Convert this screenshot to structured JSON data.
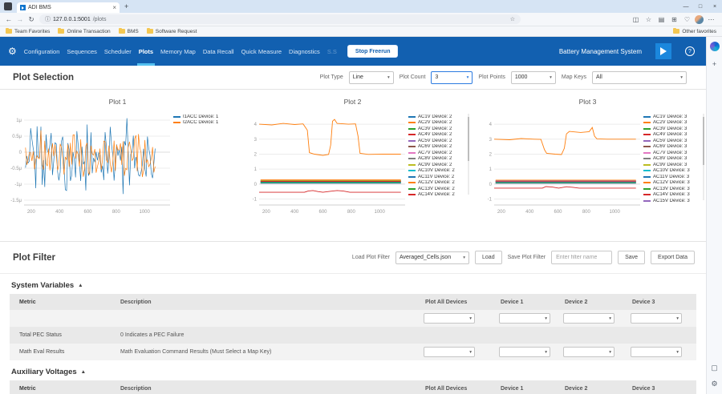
{
  "browser": {
    "tab_title": "ADI BMS",
    "url_host": "127.0.0.1:5001",
    "url_path": "/plots",
    "favorites": [
      "Team Favorites",
      "Online Transaction",
      "BMS",
      "Software Request"
    ],
    "other_favorites": "Other favorites",
    "toolbar_icons": [
      {
        "name": "split-screen-icon",
        "glyph": "◫"
      },
      {
        "name": "favorites-star-icon",
        "glyph": "☆"
      },
      {
        "name": "collections-icon",
        "glyph": "▤"
      },
      {
        "name": "extensions-icon",
        "glyph": "⊞"
      },
      {
        "name": "browser-essentials-icon",
        "glyph": "♡"
      }
    ],
    "sidebar_icons_top": [
      {
        "name": "copilot-icon",
        "glyph": ""
      },
      {
        "name": "add-icon",
        "glyph": "+"
      }
    ],
    "sidebar_icons_bottom": [
      {
        "name": "devices-icon",
        "glyph": "▢"
      },
      {
        "name": "settings-gear-icon",
        "glyph": "⚙"
      }
    ]
  },
  "nav": {
    "items": [
      "Configuration",
      "Sequences",
      "Scheduler",
      "Plots",
      "Memory Map",
      "Data Recall",
      "Quick Measure",
      "Diagnostics"
    ],
    "active_item": "Plots",
    "faint_item": "S.S",
    "stop_button": "Stop Freerun",
    "brand": "Battery Management System"
  },
  "plot_selection": {
    "title": "Plot Selection",
    "controls": [
      {
        "label": "Plot Type",
        "value": "Line",
        "focused": false
      },
      {
        "label": "Plot Count",
        "value": "3",
        "focused": true
      },
      {
        "label": "Plot Points",
        "value": "1000",
        "focused": false
      },
      {
        "label": "Map Keys",
        "value": "All",
        "focused": false
      }
    ]
  },
  "plot_filter": {
    "title": "Plot Filter",
    "load_label": "Load Plot Filter",
    "load_value": "Averaged_Cells.json",
    "load_button": "Load",
    "save_label": "Save Plot Filter",
    "save_placeholder": "Enter filter name",
    "save_button": "Save",
    "export_button": "Export Data"
  },
  "sections": [
    {
      "title": "System Variables",
      "columns": [
        "Metric",
        "Description",
        "Plot All Devices",
        "Device 1",
        "Device 2",
        "Device 3"
      ],
      "rows": [
        {
          "metric": "",
          "description": "",
          "selects": true
        },
        {
          "metric": "Total PEC Status",
          "description": "0 Indicates a PEC Failure",
          "selects": false
        },
        {
          "metric": "Math Eval Results",
          "description": "Math Evaluation Command Results (Must Select a Map Key)",
          "selects": true
        }
      ]
    },
    {
      "title": "Auxiliary Voltages",
      "columns": [
        "Metric",
        "Description",
        "Plot All Devices",
        "Device 1",
        "Device 2",
        "Device 3"
      ],
      "rows": []
    }
  ],
  "chart_data": [
    {
      "type": "line",
      "title": "Plot 1",
      "x_range": [
        150,
        1180
      ],
      "x_ticks": [
        200,
        400,
        600,
        800,
        1000
      ],
      "y_range": [
        -1.65,
        1.2
      ],
      "y_ticks": [
        {
          "v": 1,
          "label": "1μ"
        },
        {
          "v": 0.5,
          "label": "0.5μ"
        },
        {
          "v": 0,
          "label": "0"
        },
        {
          "v": -0.5,
          "label": "-0.5μ"
        },
        {
          "v": -1,
          "label": "-1μ"
        },
        {
          "v": -1.5,
          "label": "-1.5μ"
        }
      ],
      "legend_scroll": false,
      "series": [
        {
          "name": "I1ACC Device: 1",
          "color": "#1f77b4",
          "kind": "noise",
          "mean": -0.22,
          "amplitude": 1.3,
          "seed": 42
        },
        {
          "name": "I2ACC Device: 1",
          "color": "#ff7f0e",
          "kind": "noise",
          "mean": -0.2,
          "amplitude": 0.95,
          "seed": 1337
        }
      ]
    },
    {
      "type": "line",
      "title": "Plot 2",
      "x_range": [
        150,
        1180
      ],
      "x_ticks": [
        200,
        400,
        600,
        800,
        1000
      ],
      "y_range": [
        -1.4,
        4.7
      ],
      "y_ticks": [
        {
          "v": 4,
          "label": "4"
        },
        {
          "v": 3,
          "label": "3"
        },
        {
          "v": 2,
          "label": "2"
        },
        {
          "v": 1,
          "label": "1"
        },
        {
          "v": 0,
          "label": "0"
        },
        {
          "v": -1,
          "label": "-1"
        }
      ],
      "legend_scroll": true,
      "series": [
        {
          "name": "AC1V Device: 2",
          "color": "#1f77b4",
          "kind": "flat",
          "value": 0.12
        },
        {
          "name": "AC2V Device: 2",
          "color": "#ff7f0e",
          "kind": "points",
          "pts": [
            [
              150,
              4.0
            ],
            [
              240,
              3.95
            ],
            [
              320,
              4.05
            ],
            [
              400,
              3.98
            ],
            [
              460,
              4.02
            ],
            [
              490,
              3.6
            ],
            [
              505,
              2.1
            ],
            [
              540,
              2.0
            ],
            [
              600,
              1.92
            ],
            [
              640,
              1.98
            ],
            [
              655,
              2.6
            ],
            [
              668,
              4.2
            ],
            [
              682,
              4.32
            ],
            [
              700,
              4.05
            ],
            [
              780,
              4.0
            ],
            [
              830,
              4.02
            ],
            [
              848,
              3.2
            ],
            [
              862,
              2.05
            ],
            [
              920,
              1.98
            ],
            [
              1020,
              2.0
            ],
            [
              1150,
              2.0
            ]
          ]
        },
        {
          "name": "AC3V Device: 2",
          "color": "#2ca02c",
          "kind": "flat",
          "value": 0.2
        },
        {
          "name": "AC4V Device: 2",
          "color": "#d62728",
          "kind": "points",
          "pts": [
            [
              150,
              -0.55
            ],
            [
              470,
              -0.55
            ],
            [
              495,
              -0.47
            ],
            [
              530,
              -0.43
            ],
            [
              565,
              -0.5
            ],
            [
              600,
              -0.55
            ],
            [
              655,
              -0.48
            ],
            [
              700,
              -0.43
            ],
            [
              745,
              -0.47
            ],
            [
              790,
              -0.55
            ],
            [
              1150,
              -0.55
            ]
          ]
        },
        {
          "name": "AC5V Device: 2",
          "color": "#9467bd",
          "kind": "flat",
          "value": 0.05
        },
        {
          "name": "AC6V Device: 2",
          "color": "#8c564b",
          "kind": "flat",
          "value": 0.25
        },
        {
          "name": "AC7V Device: 2",
          "color": "#e377c2",
          "kind": "flat",
          "value": 0.1
        },
        {
          "name": "AC8V Device: 2",
          "color": "#7f7f7f",
          "kind": "flat",
          "value": 0.16
        },
        {
          "name": "AC9V Device: 2",
          "color": "#bcbd22",
          "kind": "flat",
          "value": 0.22
        },
        {
          "name": "AC10V Device: 2",
          "color": "#17becf",
          "kind": "flat",
          "value": 0.07
        },
        {
          "name": "AC11V Device: 2",
          "color": "#1f77b4",
          "kind": "flat",
          "value": 0.14
        },
        {
          "name": "AC12V Device: 2",
          "color": "#ff7f0e",
          "kind": "flat",
          "value": 0.28
        },
        {
          "name": "AC13V Device: 2",
          "color": "#2ca02c",
          "kind": "flat",
          "value": 0.1
        },
        {
          "name": "AC14V Device: 2",
          "color": "#d62728",
          "kind": "flat",
          "value": 0.18
        }
      ]
    },
    {
      "type": "line",
      "title": "Plot 3",
      "x_range": [
        150,
        1180
      ],
      "x_ticks": [
        200,
        400,
        600,
        800,
        1000
      ],
      "y_range": [
        -1.4,
        4.7
      ],
      "y_ticks": [
        {
          "v": 4,
          "label": "4"
        },
        {
          "v": 3,
          "label": "3"
        },
        {
          "v": 2,
          "label": "2"
        },
        {
          "v": 1,
          "label": "1"
        },
        {
          "v": 0,
          "label": "0"
        },
        {
          "v": -1,
          "label": "-1"
        }
      ],
      "legend_scroll": true,
      "series": [
        {
          "name": "AC1V Device: 3",
          "color": "#1f77b4",
          "kind": "flat",
          "value": 0.1
        },
        {
          "name": "AC2V Device: 3",
          "color": "#ff7f0e",
          "kind": "points",
          "pts": [
            [
              150,
              3.0
            ],
            [
              260,
              2.96
            ],
            [
              340,
              3.04
            ],
            [
              430,
              3.0
            ],
            [
              480,
              2.98
            ],
            [
              505,
              2.3
            ],
            [
              520,
              2.05
            ],
            [
              580,
              2.0
            ],
            [
              625,
              1.97
            ],
            [
              645,
              2.4
            ],
            [
              660,
              3.35
            ],
            [
              680,
              3.52
            ],
            [
              760,
              3.45
            ],
            [
              820,
              3.5
            ],
            [
              842,
              3.78
            ],
            [
              858,
              3.2
            ],
            [
              875,
              3.02
            ],
            [
              950,
              3.0
            ],
            [
              1150,
              3.0
            ]
          ]
        },
        {
          "name": "AC3V Device: 3",
          "color": "#2ca02c",
          "kind": "flat",
          "value": 0.18
        },
        {
          "name": "AC4V Device: 3",
          "color": "#d62728",
          "kind": "points",
          "pts": [
            [
              150,
              -0.27
            ],
            [
              490,
              -0.27
            ],
            [
              515,
              -0.17
            ],
            [
              560,
              -0.2
            ],
            [
              605,
              -0.27
            ],
            [
              660,
              -0.18
            ],
            [
              705,
              -0.22
            ],
            [
              750,
              -0.27
            ],
            [
              1150,
              -0.27
            ]
          ]
        },
        {
          "name": "AC5V Device: 3",
          "color": "#9467bd",
          "kind": "flat",
          "value": 0.05
        },
        {
          "name": "AC6V Device: 3",
          "color": "#8c564b",
          "kind": "flat",
          "value": 0.22
        },
        {
          "name": "AC7V Device: 3",
          "color": "#e377c2",
          "kind": "flat",
          "value": 0.1
        },
        {
          "name": "AC8V Device: 3",
          "color": "#7f7f7f",
          "kind": "flat",
          "value": 0.15
        },
        {
          "name": "AC9V Device: 3",
          "color": "#bcbd22",
          "kind": "flat",
          "value": 0.2
        },
        {
          "name": "AC10V Device: 3",
          "color": "#17becf",
          "kind": "flat",
          "value": 0.07
        },
        {
          "name": "AC11V Device: 3",
          "color": "#1f77b4",
          "kind": "flat",
          "value": 0.13
        },
        {
          "name": "AC12V Device: 3",
          "color": "#ff7f0e",
          "kind": "flat",
          "value": 0.26
        },
        {
          "name": "AC13V Device: 3",
          "color": "#2ca02c",
          "kind": "flat",
          "value": 0.09
        },
        {
          "name": "AC14V Device: 3",
          "color": "#d62728",
          "kind": "flat",
          "value": 0.17
        },
        {
          "name": "AC15V Device: 3",
          "color": "#9467bd",
          "kind": "flat",
          "value": 0.21
        }
      ]
    }
  ],
  "colors": {
    "nav_blue": "#1260b0",
    "active_tab_underline": "#53c0f0",
    "focus_border": "#2c7be0",
    "adi_logo_blue": "#1b87dd"
  }
}
